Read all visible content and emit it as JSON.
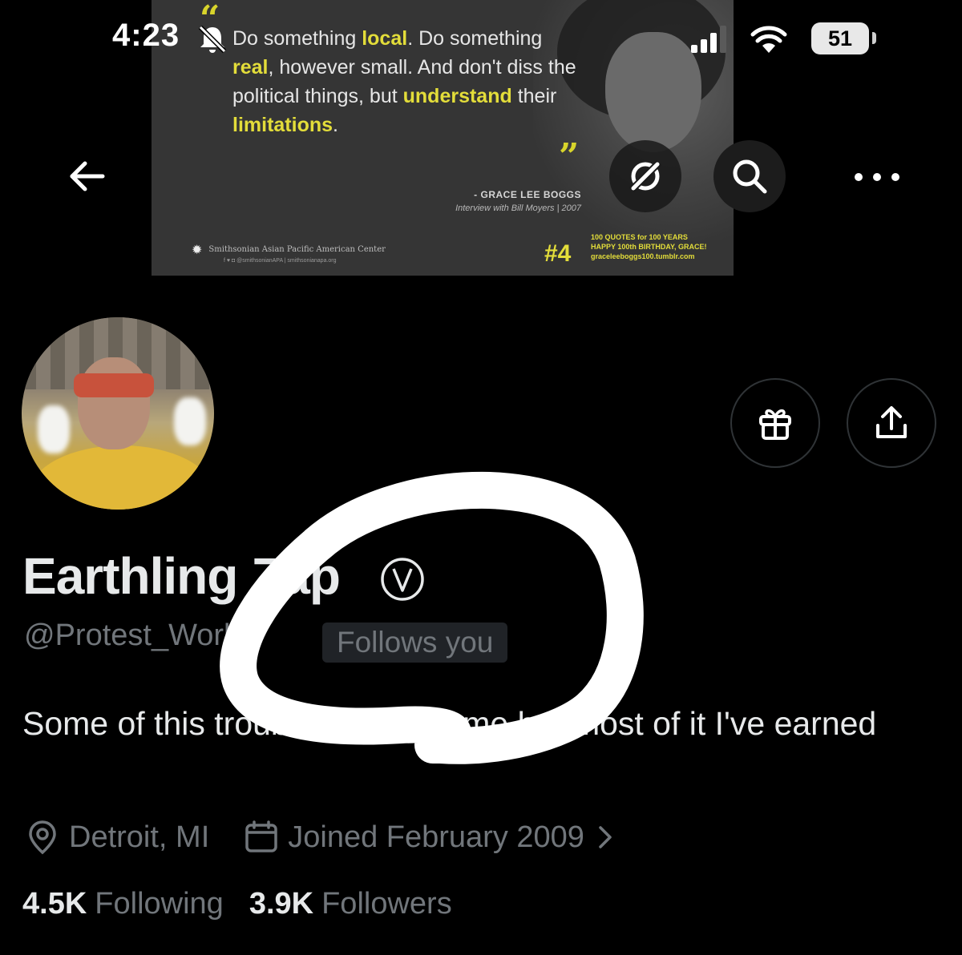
{
  "status_bar": {
    "time": "4:23",
    "battery": "51",
    "icons": [
      "bell-off-icon",
      "cellular-signal-icon",
      "wifi-icon",
      "battery-icon"
    ]
  },
  "banner": {
    "quote_parts": [
      {
        "text": "Do something ",
        "hl": false
      },
      {
        "text": "local",
        "hl": true
      },
      {
        "text": ". Do something ",
        "hl": false
      },
      {
        "text": "real",
        "hl": true
      },
      {
        "text": ", however small. And don't diss the political things, but ",
        "hl": false
      },
      {
        "text": "understand",
        "hl": true
      },
      {
        "text": " their ",
        "hl": false
      },
      {
        "text": "limitations",
        "hl": true
      },
      {
        "text": ".",
        "hl": false
      }
    ],
    "author": "- GRACE LEE BOGGS",
    "author_sub": "Interview with Bill Moyers | 2007",
    "org": "Smithsonian Asian Pacific American Center",
    "org_links": "f ♥ ◘ @smithsonianAPA | smithsonianapa.org",
    "number": "#4",
    "campaign_line1": "100 QUOTES for 100 YEARS",
    "campaign_line2": "HAPPY 100th BIRTHDAY, GRACE!",
    "campaign_line3": "graceleeboggs100.tumblr.com"
  },
  "nav": {
    "back_icon": "arrow-left-icon",
    "grok_icon": "grok-icon",
    "search_icon": "search-icon",
    "more_icon": "more-icon"
  },
  "actions": {
    "gift_icon": "gift-icon",
    "share_icon": "share-icon"
  },
  "profile": {
    "display_name": "Earthling Zap",
    "handle": "@Protest_Works",
    "follows_you": "Follows you",
    "bio": "Some of this trouble just finds me but most of it I've earned",
    "location": "Detroit, MI",
    "joined": "Joined February 2009",
    "following_count": "4.5K",
    "following_label": "Following",
    "followers_count": "3.9K",
    "followers_label": "Followers"
  },
  "colors": {
    "background": "#000000",
    "text_primary": "#e7e9ea",
    "text_secondary": "#71767b",
    "badge_bg": "#202327",
    "banner_highlight": "#e3dd3a",
    "annotation": "#ffffff"
  }
}
